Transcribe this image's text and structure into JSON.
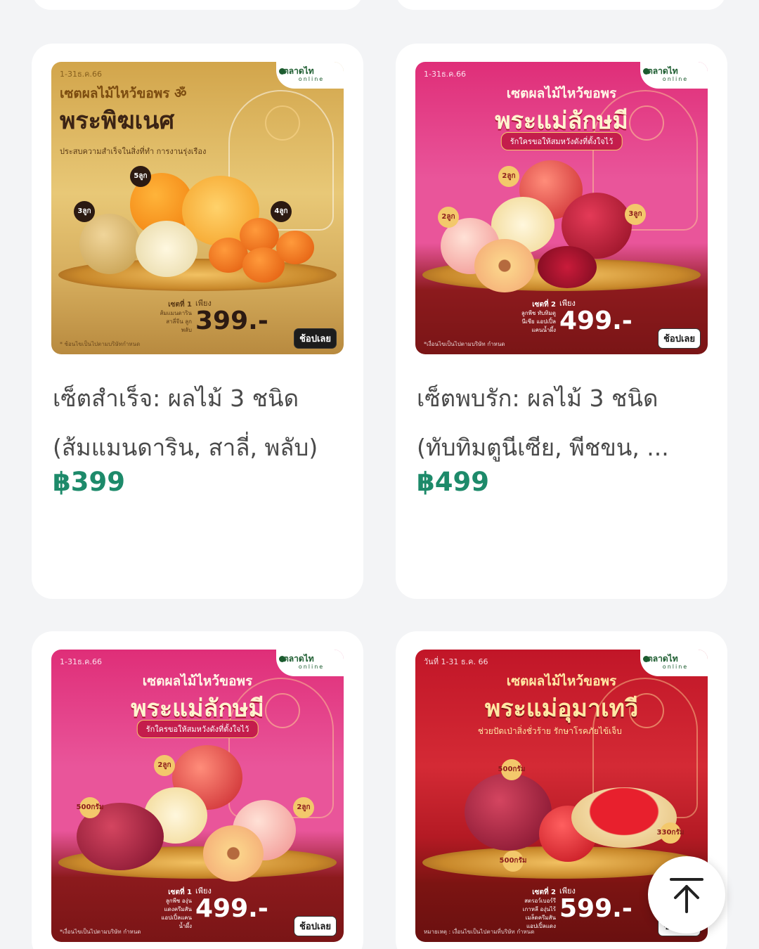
{
  "products": [
    {
      "theme": "gold",
      "banner": {
        "date": "1-31ธ.ค.66",
        "subtitle": "เซตผลไม้ไหว้ขอพร ॐ",
        "title": "พระพิฆเนศ",
        "tagline": "ประสบความสำเร็จในสิ่งที่ทำ การงานรุ่งเรือง",
        "badges": [
          {
            "num": "5",
            "unit": "ลูก"
          },
          {
            "num": "3",
            "unit": "ลูก"
          },
          {
            "num": "4",
            "unit": "ลูก"
          }
        ],
        "set_label": "เซตที่ 1",
        "set_detail": "ส้มแมนดาริน สาลี่จีน ลูกพลับ",
        "only": "เพียง",
        "price": "399.-",
        "shop": "ช้อปเลย",
        "note": "* ช้อนไขเป็นไปตามบริษัทกำหนด"
      },
      "name_line1": "เซ็ตสำเร็จ: ผลไม้ 3 ชนิด",
      "name_line2": "(ส้มแมนดาริน, สาลี่, พลับ)",
      "price": "฿399"
    },
    {
      "theme": "pink",
      "banner": {
        "date": "1-31ธ.ค.66",
        "subtitle": "เซตผลไม้ไหว้ขอพร",
        "title": "พระแม่ลักษมี",
        "tagline": "รักใครขอให้สมหวังดังที่ตั้งใจไว้",
        "badges": [
          {
            "num": "2",
            "unit": "ลูก"
          },
          {
            "num": "2",
            "unit": "ลูก"
          },
          {
            "num": "3",
            "unit": "ลูก"
          }
        ],
        "set_label": "เซตที่ 2",
        "set_detail": "ลูกพีช ทับทิมตูนีเซีย แอปเปิ้ลแคนน้ำผึ้ง",
        "only": "เพียง",
        "price": "499.-",
        "shop": "ช้อปเลย",
        "note": "*เงื่อนไขเป็นไปตามบริษัท กำหนด"
      },
      "name_line1": "เซ็ตพบรัก: ผลไม้ 3 ชนิด",
      "name_line2": "(ทับทิมตูนีเซีย, พีชขน, ...",
      "price": "฿499"
    },
    {
      "theme": "pink",
      "banner": {
        "date": "1-31ธ.ค.66",
        "subtitle": "เซตผลไม้ไหว้ขอพร",
        "title": "พระแม่ลักษมี",
        "tagline": "รักใครขอให้สมหวังดังที่ตั้งใจไว้",
        "badges": [
          {
            "num": "2",
            "unit": "ลูก"
          },
          {
            "num": "500",
            "unit": "กรัม"
          },
          {
            "num": "2",
            "unit": "ลูก"
          }
        ],
        "set_label": "เซตที่ 1",
        "set_detail": "ลูกพีช องุ่นแดงครีมสัน แอปเปิ้ลแคนน้ำผึ้ง",
        "only": "เพียง",
        "price": "499.-",
        "shop": "ช้อปเลย",
        "note": "*เงื่อนไขเป็นไปตามบริษัท กำหนด"
      }
    },
    {
      "theme": "red",
      "banner": {
        "date": "วันที่ 1-31 ธ.ค. 66",
        "subtitle": "เซตผลไม้ไหว้ขอพร",
        "title": "พระแม่อุมาเทวี",
        "tagline": "ช่วยปัดเป่าสิ่งชั่วร้าย รักษาโรคภัยไข้เจ็บ",
        "badges": [
          {
            "num": "500",
            "unit": "กรัม"
          },
          {
            "num": "500",
            "unit": "กรัม"
          },
          {
            "num": "330",
            "unit": "กรัม"
          }
        ],
        "set_label": "เซตที่ 2",
        "set_detail": "สตรอว์เบอร์รีเกาหลี องุ่นไร้เมล็ดครีมสัน แอปเปิ้ลแดง",
        "only": "เพียง",
        "price": "599.-",
        "shop": "ช้อปเลย",
        "note": "หมายเหตุ : เงื่อนไขเป็นไปตามที่บริษัท กำหนด"
      }
    }
  ],
  "logo": {
    "name": "ตลาดไท",
    "sub": "online"
  },
  "icons": {
    "scroll_top": "arrow-up-to-top-icon"
  }
}
